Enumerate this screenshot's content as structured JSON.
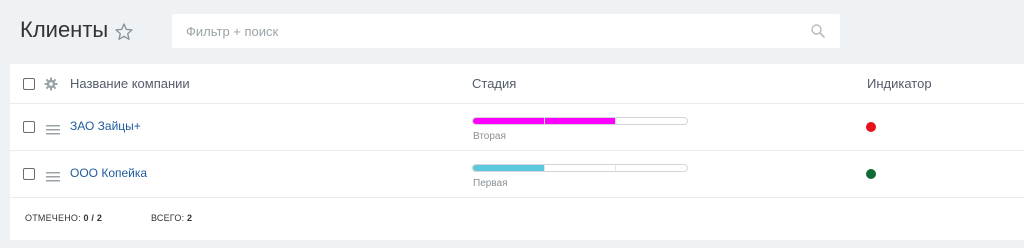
{
  "page": {
    "title": "Клиенты"
  },
  "search": {
    "placeholder": "Фильтр + поиск"
  },
  "table": {
    "columns": {
      "name": "Название компании",
      "stage": "Стадия",
      "indicator": "Индикатор"
    },
    "rows": [
      {
        "name": "ЗАО Зайцы+",
        "stage_label": "Вторая",
        "stage_color": "#ff00ff",
        "stage_filled_segments": 2,
        "stage_total_segments": 3,
        "indicator_color": "#e8101a"
      },
      {
        "name": "ООО Копейка",
        "stage_label": "Первая",
        "stage_color": "#5bc8dc",
        "stage_filled_segments": 1,
        "stage_total_segments": 3,
        "indicator_color": "#0f6b36"
      }
    ]
  },
  "footer": {
    "selected_label": "ОТМЕЧЕНО:",
    "selected_value": "0 / 2",
    "total_label": "ВСЕГО:",
    "total_value": "2"
  },
  "colors": {
    "background": "#eef2f4",
    "link": "#1f5a9e"
  },
  "icons": {
    "favorite": "star-icon",
    "search": "search-icon",
    "settings": "gear-icon",
    "drag": "drag-handle-icon"
  }
}
